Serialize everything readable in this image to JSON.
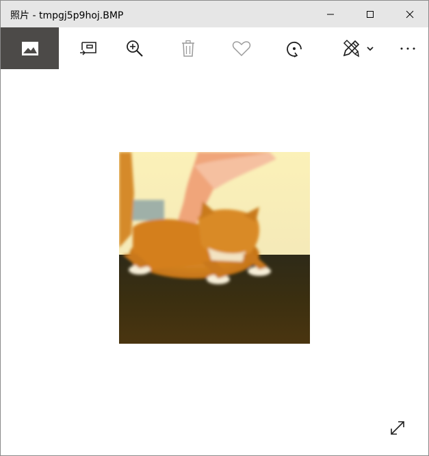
{
  "window": {
    "title": "照片 - tmpgj5p9hoj.BMP",
    "controls": [
      "minimize-icon",
      "maximize-icon",
      "close-icon"
    ]
  },
  "toolbar": {
    "items": [
      {
        "icon": "image-icon",
        "active": true
      },
      {
        "icon": "slideshow-icon",
        "active": false
      },
      {
        "icon": "zoom-in-icon",
        "active": false
      },
      {
        "icon": "delete-icon",
        "active": false,
        "disabled": true
      },
      {
        "icon": "favorite-icon",
        "active": false,
        "disabled": true
      },
      {
        "icon": "rotate-icon",
        "active": false
      },
      {
        "icon": "edit-draw-icon",
        "active": false
      },
      {
        "icon": "chevron-down-icon",
        "active": false
      },
      {
        "icon": "more-options-icon",
        "active": false
      }
    ],
    "more_label": "···"
  },
  "viewer": {
    "photo_icon": "cat-photo",
    "expand_icon": "expand-icon"
  },
  "colors": {
    "titlebar": "#e6e6e6",
    "active_tool": "#4c4a48",
    "icon": "#1f1f1f",
    "icon_disabled": "#9a9a9a"
  }
}
